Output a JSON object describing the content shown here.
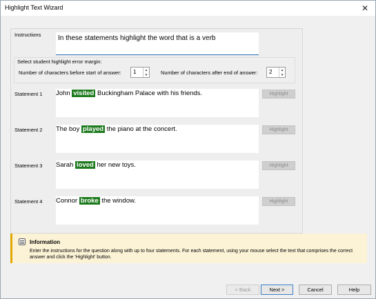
{
  "window": {
    "title": "Highlight Text Wizard",
    "close_glyph": "✕"
  },
  "instructions": {
    "label": "Instructions",
    "value": "In these statements highlight the word that is a verb"
  },
  "margin": {
    "heading": "Select student highlight error margin:",
    "before_label": "Number of characters before start of answer:",
    "before_value": "1",
    "after_label": "Number of characters after end of answer:",
    "after_value": "2",
    "up_glyph": "▲",
    "down_glyph": "▼"
  },
  "statements": [
    {
      "label": "Statement 1",
      "pre": "John ",
      "hl": "visited",
      "post": " Buckingham Palace with his friends.",
      "button": "Highlight"
    },
    {
      "label": "Statement 2",
      "pre": "The boy ",
      "hl": "played",
      "post": " the piano at the concert.",
      "button": "Highlight"
    },
    {
      "label": "Statement 3",
      "pre": "Sarah ",
      "hl": "loved",
      "post": " her new toys.",
      "button": "Highlight"
    },
    {
      "label": "Statement 4",
      "pre": "Connor ",
      "hl": "broke",
      "post": " the window.",
      "button": "Highlight"
    }
  ],
  "info": {
    "title": "Information",
    "body": "Enter the instructions for the question along with up to four statements.  For each statement, using your mouse select the text that comprises the correct answer and click the 'Highlight' button."
  },
  "buttons": {
    "back": "< Back",
    "next": "Next >",
    "cancel": "Cancel",
    "help": "Help"
  },
  "colors": {
    "highlight": "#1e7a1e",
    "info_background": "#fcf3d6",
    "info_accent": "#e0a800"
  }
}
